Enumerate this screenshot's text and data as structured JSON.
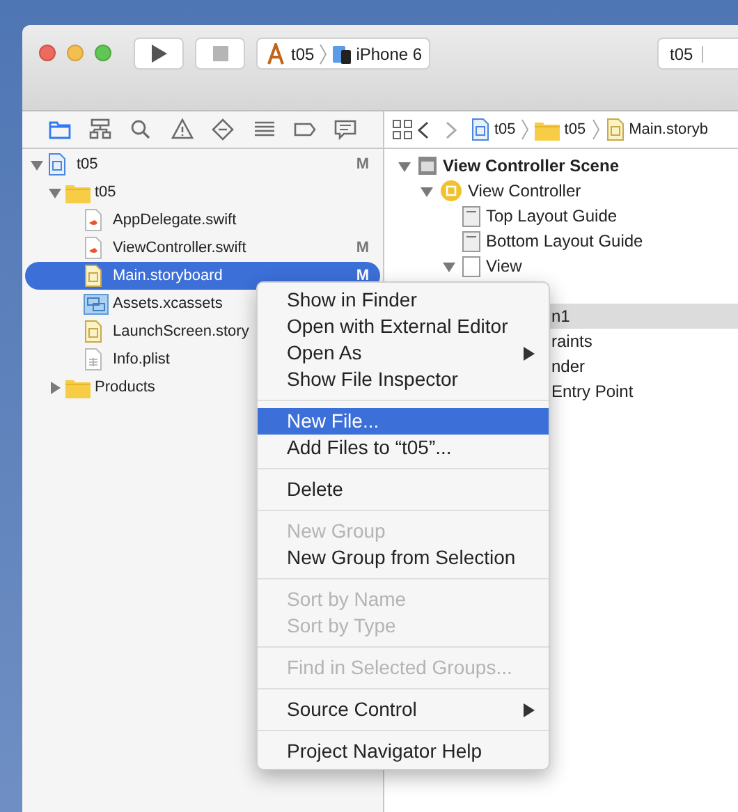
{
  "toolbar": {
    "scheme": "t05",
    "device": "iPhone 6",
    "activity": "t05"
  },
  "jump_bar": [
    "t05",
    "t05",
    "Main.storyb"
  ],
  "navigator_tabs": [
    {
      "selected": true
    },
    {
      "selected": false
    },
    {
      "selected": false
    },
    {
      "selected": false
    },
    {
      "selected": false
    },
    {
      "selected": false
    },
    {
      "selected": false
    },
    {
      "selected": false
    }
  ],
  "tree": [
    {
      "label": "t05",
      "kind": "project",
      "badge": "M",
      "expanded": true,
      "selected": false,
      "children": [
        {
          "label": "t05",
          "kind": "folder",
          "expanded": true,
          "selected": false,
          "children": [
            {
              "label": "AppDelegate.swift",
              "kind": "swift",
              "selected": false
            },
            {
              "label": "ViewController.swift",
              "kind": "swift",
              "badge": "M",
              "selected": false
            },
            {
              "label": "Main.storyboard",
              "kind": "storyboard",
              "badge": "M",
              "selected": true
            },
            {
              "label": "Assets.xcassets",
              "kind": "assets",
              "selected": false
            },
            {
              "label": "LaunchScreen.story",
              "kind": "storyboard",
              "selected": false
            },
            {
              "label": "Info.plist",
              "kind": "plist",
              "selected": false
            }
          ]
        },
        {
          "label": "Products",
          "kind": "folder",
          "expanded": false,
          "selected": false
        }
      ]
    }
  ],
  "outline": [
    {
      "label": "View Controller Scene",
      "kind": "scene",
      "expanded": true,
      "selected": false,
      "children": [
        {
          "label": "View Controller",
          "kind": "controller",
          "expanded": true,
          "selected": false,
          "children": [
            {
              "label": "Top Layout Guide",
              "kind": "guide",
              "selected": false
            },
            {
              "label": "Bottom Layout Guide",
              "kind": "guide",
              "selected": false
            },
            {
              "label": "View",
              "kind": "view",
              "expanded": true,
              "selected": false,
              "children": [
                {
                  "label": "n1",
                  "kind": "partial",
                  "selected": true
                },
                {
                  "label": "raints",
                  "kind": "partial",
                  "selected": false
                },
                {
                  "label": "nder",
                  "kind": "partial",
                  "selected": false
                }
              ]
            },
            {
              "label": "Entry Point",
              "kind": "partial",
              "selected": false
            }
          ]
        }
      ]
    }
  ],
  "context_menu": [
    {
      "kind": "item",
      "label": "Show in Finder",
      "disabled": false,
      "selected": false,
      "submenu": false
    },
    {
      "kind": "item",
      "label": "Open with External Editor",
      "disabled": false,
      "selected": false,
      "submenu": false
    },
    {
      "kind": "item",
      "label": "Open As",
      "disabled": false,
      "selected": false,
      "submenu": true
    },
    {
      "kind": "item",
      "label": "Show File Inspector",
      "disabled": false,
      "selected": false,
      "submenu": false
    },
    {
      "kind": "separator"
    },
    {
      "kind": "item",
      "label": "New File...",
      "disabled": false,
      "selected": true,
      "submenu": false
    },
    {
      "kind": "item",
      "label": "Add Files to “t05”...",
      "disabled": false,
      "selected": false,
      "submenu": false
    },
    {
      "kind": "separator"
    },
    {
      "kind": "item",
      "label": "Delete",
      "disabled": false,
      "selected": false,
      "submenu": false
    },
    {
      "kind": "separator"
    },
    {
      "kind": "item",
      "label": "New Group",
      "disabled": true,
      "selected": false,
      "submenu": false
    },
    {
      "kind": "item",
      "label": "New Group from Selection",
      "disabled": false,
      "selected": false,
      "submenu": false
    },
    {
      "kind": "separator"
    },
    {
      "kind": "item",
      "label": "Sort by Name",
      "disabled": true,
      "selected": false,
      "submenu": false
    },
    {
      "kind": "item",
      "label": "Sort by Type",
      "disabled": true,
      "selected": false,
      "submenu": false
    },
    {
      "kind": "separator"
    },
    {
      "kind": "item",
      "label": "Find in Selected Groups...",
      "disabled": true,
      "selected": false,
      "submenu": false
    },
    {
      "kind": "separator"
    },
    {
      "kind": "item",
      "label": "Source Control",
      "disabled": false,
      "selected": false,
      "submenu": true
    },
    {
      "kind": "separator"
    },
    {
      "kind": "item",
      "label": "Project Navigator Help",
      "disabled": false,
      "selected": false,
      "submenu": false
    }
  ]
}
